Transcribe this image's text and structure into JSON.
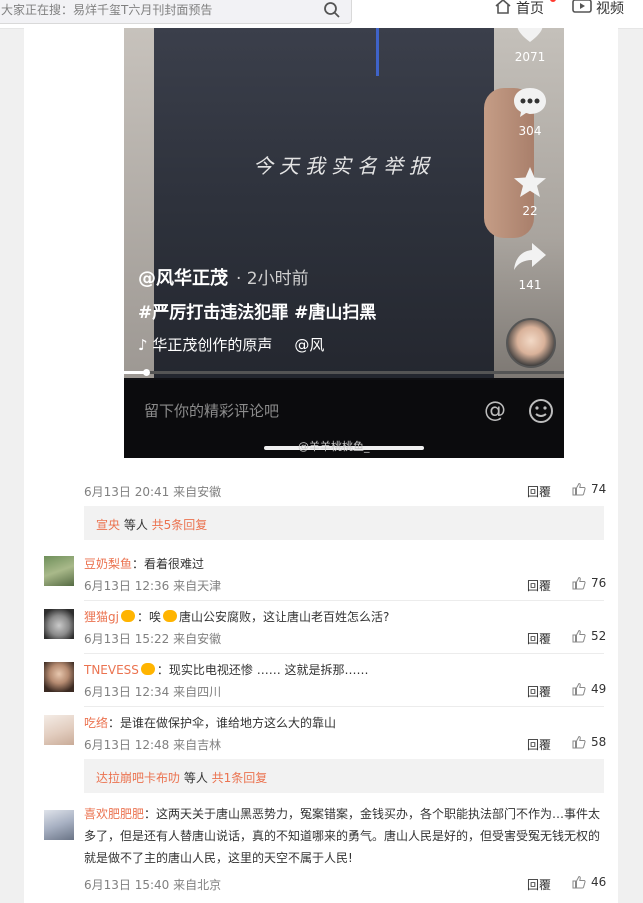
{
  "search": {
    "placeholder": "大家正在搜：易烊千玺T六月刊封面预告"
  },
  "nav": {
    "home": "首页",
    "video": "视频"
  },
  "video": {
    "shirt_text": "今天我实名举报",
    "author": "@风华正茂",
    "time": "· 2小时前",
    "tags": "#严厉打击违法犯罪 #唐山扫黑",
    "music": "♪ 华正茂创作的原声",
    "music_at": "@风",
    "likes": "2071",
    "comments": "304",
    "favorites": "22",
    "shares": "141",
    "progress": 0.05,
    "comment_placeholder": "留下你的精彩评论吧",
    "watermark": "@羊羊桃桃鱼_"
  },
  "post_meta": {
    "date": "6月13日 20:41 来自安徽",
    "reply": "回覆",
    "likes": "74"
  },
  "thread1": {
    "name": "宣央",
    "mid": " 等人 ",
    "count": "共5条回复"
  },
  "comments": [
    {
      "name": "豆奶梨鱼",
      "text": "：看着很难过",
      "meta": "6月13日 12:36 来自天津",
      "reply": "回覆",
      "likes": "76"
    },
    {
      "name": "狸猫gj",
      "text": "：唉",
      "text2": "唐山公安腐败，这让唐山老百姓怎么活?",
      "meta": "6月13日 15:22 来自安徽",
      "reply": "回覆",
      "likes": "52"
    },
    {
      "name": "TNEVESS",
      "text": "：现实比电视还惨 …… 这就是拆那……",
      "meta": "6月13日 12:34 来自四川",
      "reply": "回覆",
      "likes": "49"
    },
    {
      "name": "吃络",
      "text": "：是谁在做保护伞，谁给地方这么大的靠山",
      "meta": "6月13日 12:48 来自吉林",
      "reply": "回覆",
      "likes": "58"
    }
  ],
  "thread2": {
    "name": "达拉崩吧卡布叻",
    "mid": " 等人 ",
    "count": "共1条回复"
  },
  "last_comment": {
    "name": "喜欢肥肥肥",
    "text": "：这两天关于唐山黑恶势力，冤案错案，金钱买办，各个职能执法部门不作为…事件太多了，但是还有人替唐山说话，真的不知道哪来的勇气。唐山人民是好的，但受害受冤无钱无权的就是做不了主的唐山人民，这里的天空不属于人民!",
    "meta": "6月13日 15:40 来自北京",
    "reply": "回覆",
    "likes": "46"
  }
}
